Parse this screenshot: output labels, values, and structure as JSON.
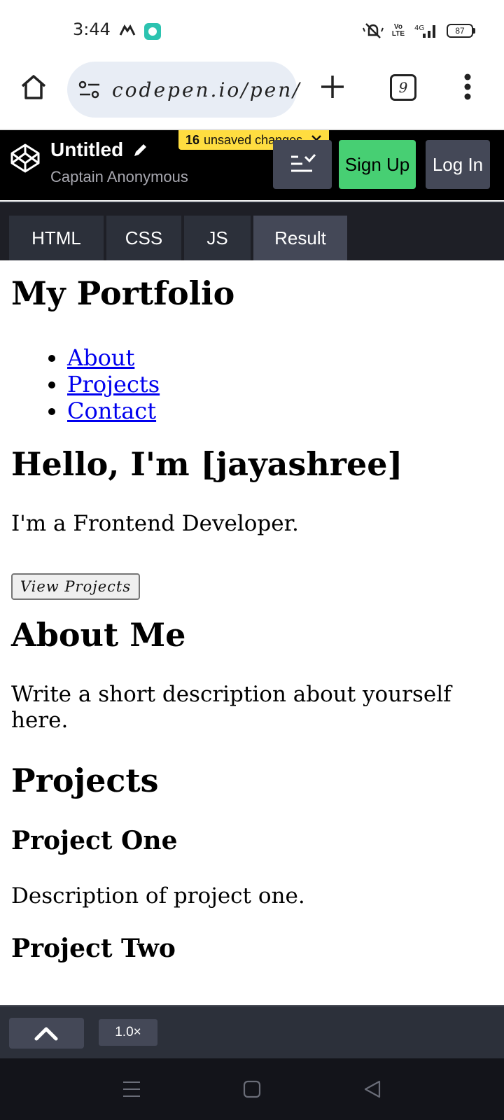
{
  "status_bar": {
    "time": "3:44",
    "volte": "Vo\nLTE",
    "network": "4G",
    "battery": "87"
  },
  "browser": {
    "url": "codepen.io/pen/",
    "tab_count": "9"
  },
  "codepen": {
    "title": "Untitled",
    "author": "Captain Anonymous",
    "unsaved_count": "16",
    "unsaved_text": "unsaved changes",
    "signup_label": "Sign Up",
    "login_label": "Log In",
    "tabs": [
      {
        "label": "HTML",
        "active": false
      },
      {
        "label": "CSS",
        "active": false
      },
      {
        "label": "JS",
        "active": false
      },
      {
        "label": "Result",
        "active": true
      }
    ],
    "zoom": "1.0×",
    "colors": {
      "header_bg": "#000000",
      "signup": "#47cf73",
      "unsaved_badge": "#ffdd40",
      "panel": "#444857"
    }
  },
  "result": {
    "heading": "My Portfolio",
    "nav_links": [
      "About",
      "Projects",
      "Contact"
    ],
    "hero_heading": "Hello, I'm [jayashree]",
    "hero_text": "I'm a Frontend Developer.",
    "view_projects_button": "View Projects",
    "about_heading": "About Me",
    "about_text": "Write a short description about yourself here.",
    "projects_heading": "Projects",
    "project_one_title": "Project One",
    "project_one_desc": "Description of project one.",
    "project_two_title": "Project Two"
  }
}
